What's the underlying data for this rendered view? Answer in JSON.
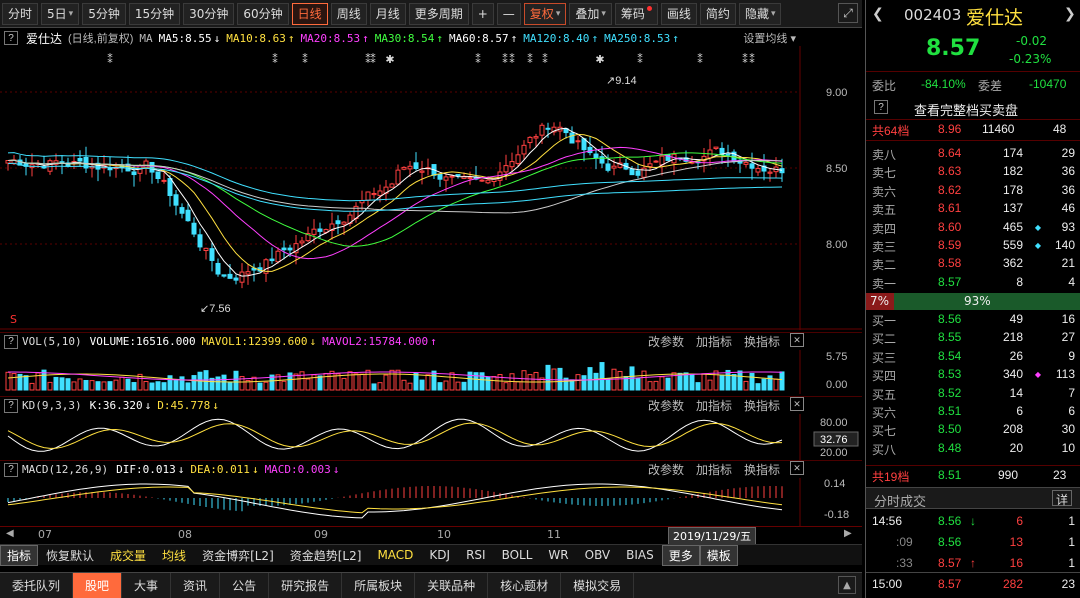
{
  "toolbar": {
    "items": [
      "分时",
      "5日",
      "5分钟",
      "15分钟",
      "30分钟",
      "60分钟",
      "日线",
      "周线",
      "月线",
      "更多周期",
      "+",
      "—",
      "复权",
      "叠加",
      "筹码",
      "画线",
      "简约",
      "隐藏"
    ],
    "active": "日线",
    "expand_icon": "expand-icon"
  },
  "header": {
    "name": "爱仕达",
    "subtitle": "(日线,前复权)",
    "ma_prefix": "MA",
    "ma": [
      {
        "label": "MA5:8.55",
        "color": "#ffffff",
        "arrow": "↓"
      },
      {
        "label": "MA10:8.63",
        "color": "#ffe040",
        "arrow": "↑"
      },
      {
        "label": "MA20:8.53",
        "color": "#ff40ff",
        "arrow": "↑"
      },
      {
        "label": "MA30:8.54",
        "color": "#40ff40",
        "arrow": "↑"
      },
      {
        "label": "MA60:8.57",
        "color": "#ffffff",
        "arrow": "↑"
      },
      {
        "label": "MA120:8.40",
        "color": "#40e0ff",
        "arrow": "↑"
      },
      {
        "label": "MA250:8.53",
        "color": "#40e0ff",
        "arrow": "↑"
      }
    ],
    "settings": "设置均线"
  },
  "main_chart": {
    "y_ticks": [
      "9.00",
      "8.50",
      "8.00"
    ],
    "high_label": "9.14",
    "low_label": "7.56"
  },
  "vol": {
    "title": "VOL(5,10)",
    "volume": "VOLUME:16516.000",
    "mavol1": "MAVOL1:12399.600",
    "mavol2": "MAVOL2:15784.000",
    "y_ticks": [
      "5.75",
      "0.00"
    ]
  },
  "kd": {
    "title": "KD(9,3,3)",
    "k": "K:36.320",
    "d": "D:45.778",
    "y_ticks": [
      "80.00",
      "32.76",
      "20.00"
    ]
  },
  "macd": {
    "title": "MACD(12,26,9)",
    "dif": "DIF:0.013",
    "dea": "DEA:0.011",
    "macd": "MACD:0.003",
    "y_ticks": [
      "0.14",
      "-0.18"
    ]
  },
  "panel_buttons": [
    "改参数",
    "加指标",
    "换指标"
  ],
  "xaxis": {
    "labels": [
      "07",
      "08",
      "09",
      "10",
      "11"
    ],
    "date": "2019/11/29/五"
  },
  "tabs": [
    "指标",
    "恢复默认",
    "成交量",
    "均线",
    "资金博弈[L2]",
    "资金趋势[L2]",
    "MACD",
    "KDJ",
    "RSI",
    "BOLL",
    "WR",
    "OBV",
    "BIAS",
    "更多",
    "模板"
  ],
  "bottom": [
    "委托队列",
    "股吧",
    "大事",
    "资讯",
    "公告",
    "研究报告",
    "所属板块",
    "关联品种",
    "核心题材",
    "模拟交易"
  ],
  "quote": {
    "code": "002403",
    "name": "爱仕达",
    "price": "8.57",
    "change": "-0.02",
    "pct": "-0.23%",
    "wb_label": "委比",
    "wb": "-84.10%",
    "wc_label": "委差",
    "wc": "-10470",
    "full_btn": "查看完整档买卖盘",
    "sell_total": {
      "label": "共64档",
      "price": "8.96",
      "vol": "11460",
      "n": "48"
    },
    "sells": [
      {
        "label": "卖八",
        "price": "8.64",
        "vol": "174",
        "n": "29"
      },
      {
        "label": "卖七",
        "price": "8.63",
        "vol": "182",
        "n": "36"
      },
      {
        "label": "卖六",
        "price": "8.62",
        "vol": "178",
        "n": "36"
      },
      {
        "label": "卖五",
        "price": "8.61",
        "vol": "137",
        "n": "46"
      },
      {
        "label": "卖四",
        "price": "8.60",
        "vol": "465",
        "n": "93"
      },
      {
        "label": "卖三",
        "price": "8.59",
        "vol": "559",
        "n": "140"
      },
      {
        "label": "卖二",
        "price": "8.58",
        "vol": "362",
        "n": "21"
      },
      {
        "label": "卖一",
        "price": "8.57",
        "vol": "8",
        "n": "4"
      }
    ],
    "ratio_sell": "7%",
    "ratio_buy": "93%",
    "buys": [
      {
        "label": "买一",
        "price": "8.56",
        "vol": "49",
        "n": "16"
      },
      {
        "label": "买二",
        "price": "8.55",
        "vol": "218",
        "n": "27"
      },
      {
        "label": "买三",
        "price": "8.54",
        "vol": "26",
        "n": "9"
      },
      {
        "label": "买四",
        "price": "8.53",
        "vol": "340",
        "n": "113"
      },
      {
        "label": "买五",
        "price": "8.52",
        "vol": "14",
        "n": "7"
      },
      {
        "label": "买六",
        "price": "8.51",
        "vol": "6",
        "n": "6"
      },
      {
        "label": "买七",
        "price": "8.50",
        "vol": "208",
        "n": "30"
      },
      {
        "label": "买八",
        "price": "8.48",
        "vol": "20",
        "n": "10"
      }
    ],
    "buy_total": {
      "label": "共19档",
      "price": "8.51",
      "vol": "990",
      "n": "23"
    },
    "ticks_title": "分时成交",
    "ticks_btn": "详",
    "ticks": [
      {
        "time": "14:56",
        "price": "8.56",
        "arrow": "↓",
        "vol": "6",
        "n": "1"
      },
      {
        "time": ":09",
        "price": "8.56",
        "arrow": "",
        "vol": "13",
        "n": "1"
      },
      {
        "time": ":33",
        "price": "8.57",
        "arrow": "↑",
        "vol": "16",
        "n": "1"
      },
      {
        "time": "15:00",
        "price": "8.57",
        "arrow": "",
        "vol": "282",
        "n": "23"
      }
    ]
  }
}
